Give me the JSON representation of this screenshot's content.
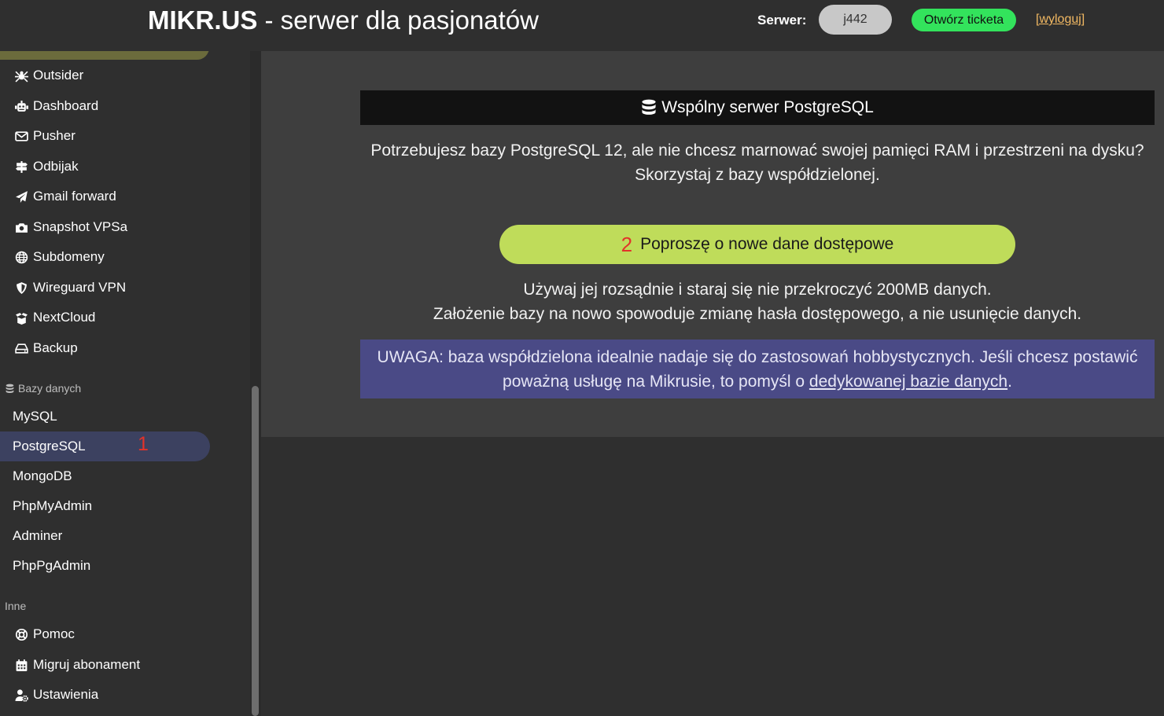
{
  "header": {
    "brand": "MIKR.US",
    "tagline": " - serwer dla pasjonatów",
    "server_label": "Serwer:",
    "server_value": "j442",
    "ticket_label": "Otwórz ticketa",
    "logout_label": "[wyloguj]"
  },
  "sidebar": {
    "items": [
      {
        "label": "Outsider",
        "icon": "spider-icon"
      },
      {
        "label": "Dashboard",
        "icon": "robot-icon"
      },
      {
        "label": "Pusher",
        "icon": "envelope-icon"
      },
      {
        "label": "Odbijak",
        "icon": "signs-icon"
      },
      {
        "label": "Gmail forward",
        "icon": "paper-plane-icon"
      },
      {
        "label": "Snapshot VPSa",
        "icon": "camera-icon"
      },
      {
        "label": "Subdomeny",
        "icon": "globe-icon"
      },
      {
        "label": "Wireguard VPN",
        "icon": "shield-icon"
      },
      {
        "label": "NextCloud",
        "icon": "box-open-icon"
      },
      {
        "label": "Backup",
        "icon": "hdd-icon"
      }
    ],
    "databases_label": "Bazy danych",
    "databases": [
      "MySQL",
      "PostgreSQL",
      "MongoDB",
      "PhpMyAdmin",
      "Adminer",
      "PhpPgAdmin"
    ],
    "other_label": "Inne",
    "other": [
      {
        "label": "Pomoc",
        "icon": "life-ring-icon"
      },
      {
        "label": "Migruj abonament",
        "icon": "calendar-icon"
      },
      {
        "label": "Ustawienia",
        "icon": "user-cog-icon"
      }
    ],
    "active_marker": "1"
  },
  "main": {
    "card_title": "Wspólny serwer PostgreSQL",
    "intro_line1": "Potrzebujesz bazy PostgreSQL 12, ale nie chcesz marnować swojej pamięci RAM i przestrzeni na dysku?",
    "intro_line2": "Skorzystaj z bazy współdzielonej.",
    "button_marker": "2",
    "button_label": "Poproszę o nowe dane dostępowe",
    "usage_line1": "Używaj jej rozsądnie i staraj się nie przekroczyć 200MB danych.",
    "usage_line2": "Założenie bazy na nowo spowoduje zmianę hasła dostępowego, a nie usunięcie danych.",
    "warning_text": "UWAGA: baza współdzielona idealnie nadaje się do zastosowań hobbystycznych. Jeśli chcesz postawić poważną usługę na Mikrusie, to pomyśl o ",
    "warning_link": "dedykowanej bazie danych",
    "warning_end": "."
  },
  "colors": {
    "active_item": "#3c4160",
    "request_button": "#bfdc5a",
    "ticket_button": "#33e35c",
    "warning_bg": "#4a4a86",
    "marker": "#e2332a"
  }
}
